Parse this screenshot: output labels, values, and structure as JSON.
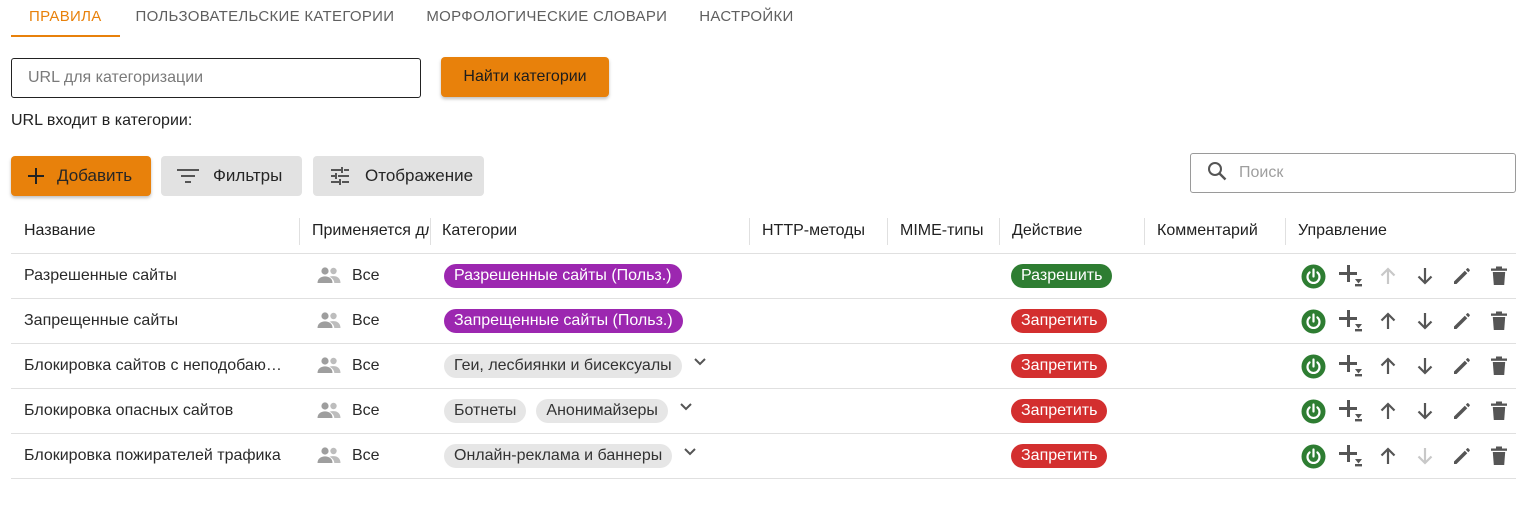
{
  "tabs": [
    {
      "label": "ПРАВИЛА",
      "active": true
    },
    {
      "label": "ПОЛЬЗОВАТЕЛЬСКИЕ КАТЕГОРИИ",
      "active": false
    },
    {
      "label": "МОРФОЛОГИЧЕСКИЕ СЛОВАРИ",
      "active": false
    },
    {
      "label": "НАСТРОЙКИ",
      "active": false
    }
  ],
  "url_check": {
    "placeholder": "URL для категоризации",
    "value": "",
    "button_label": "Найти категории",
    "result_label": "URL входит в категории:"
  },
  "toolbar": {
    "add_label": "Добавить",
    "filters_label": "Фильтры",
    "display_label": "Отображение",
    "search_placeholder": "Поиск"
  },
  "table": {
    "headers": {
      "name": "Название",
      "applies": "Применяется для",
      "categories": "Категории",
      "http_methods": "HTTP-методы",
      "mime_types": "MIME-типы",
      "action": "Действие",
      "comment": "Комментарий",
      "manage": "Управление"
    },
    "rows": [
      {
        "name": "Разрешенные сайты",
        "applies": "Все",
        "categories": [
          "Разрешенные сайты (Польз.)"
        ],
        "categories_style": "purple",
        "expandable": false,
        "action": "Разрешить",
        "action_kind": "allow",
        "enabled": true,
        "can_move_up": false,
        "can_move_down": true
      },
      {
        "name": "Запрещенные сайты",
        "applies": "Все",
        "categories": [
          "Запрещенные сайты (Польз.)"
        ],
        "categories_style": "purple",
        "expandable": false,
        "action": "Запретить",
        "action_kind": "deny",
        "enabled": true,
        "can_move_up": true,
        "can_move_down": true
      },
      {
        "name": "Блокировка сайтов с неподобающим содержимым",
        "applies": "Все",
        "categories": [
          "Геи, лесбиянки и бисексуалы"
        ],
        "categories_style": "grey",
        "expandable": true,
        "action": "Запретить",
        "action_kind": "deny",
        "enabled": true,
        "can_move_up": true,
        "can_move_down": true
      },
      {
        "name": "Блокировка опасных сайтов",
        "applies": "Все",
        "categories": [
          "Ботнеты",
          "Анонимайзеры"
        ],
        "categories_style": "grey",
        "expandable": true,
        "action": "Запретить",
        "action_kind": "deny",
        "enabled": true,
        "can_move_up": true,
        "can_move_down": true
      },
      {
        "name": "Блокировка пожирателей трафика",
        "applies": "Все",
        "categories": [
          "Онлайн-реклама и баннеры"
        ],
        "categories_style": "grey",
        "expandable": true,
        "action": "Запретить",
        "action_kind": "deny",
        "enabled": true,
        "can_move_up": true,
        "can_move_down": false
      }
    ]
  },
  "colors": {
    "accent": "#e8810b",
    "allow": "#2e7d32",
    "deny": "#d32f2f",
    "user_category": "#9c27b0",
    "icon": "#555555",
    "icon_disabled": "#c8c8c8",
    "power": "#2e7d32"
  },
  "icons": {
    "add": "plus-icon",
    "filters": "filter-list-icon",
    "display": "tune-icon",
    "search": "search-icon",
    "applies": "people-icon",
    "expand": "chevron-down-icon",
    "power": "power-icon",
    "add_below": "add-below-icon",
    "move_up": "arrow-up-icon",
    "move_down": "arrow-down-icon",
    "edit": "pencil-icon",
    "delete": "trash-icon"
  }
}
